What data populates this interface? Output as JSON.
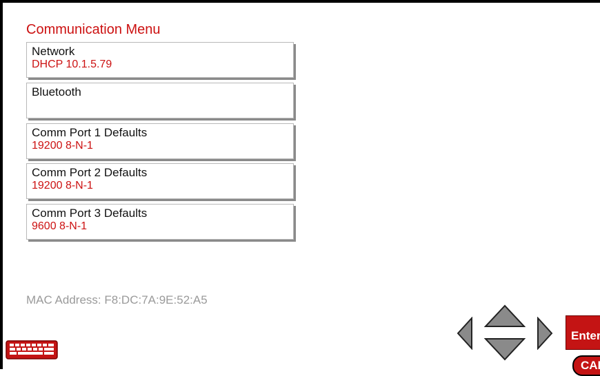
{
  "menu": {
    "title": "Communication Menu",
    "items": [
      {
        "label": "Network",
        "value": "DHCP 10.1.5.79"
      },
      {
        "label": "Bluetooth",
        "value": ""
      },
      {
        "label": "Comm Port 1 Defaults",
        "value": "19200 8-N-1"
      },
      {
        "label": "Comm Port 2 Defaults",
        "value": "19200 8-N-1"
      },
      {
        "label": "Comm Port 3 Defaults",
        "value": "9600 8-N-1"
      }
    ]
  },
  "mac_address": "MAC Address: F8:DC:7A:9E:52:A5",
  "controls": {
    "enter_label": "Enter",
    "cal_label": "CAL",
    "icons": [
      "keyboard-icon",
      "arrow-left-icon",
      "arrow-up-icon",
      "arrow-down-icon",
      "arrow-right-icon"
    ]
  },
  "colors": {
    "accent": "#cc1111",
    "muted_text": "#9a9a9a"
  }
}
